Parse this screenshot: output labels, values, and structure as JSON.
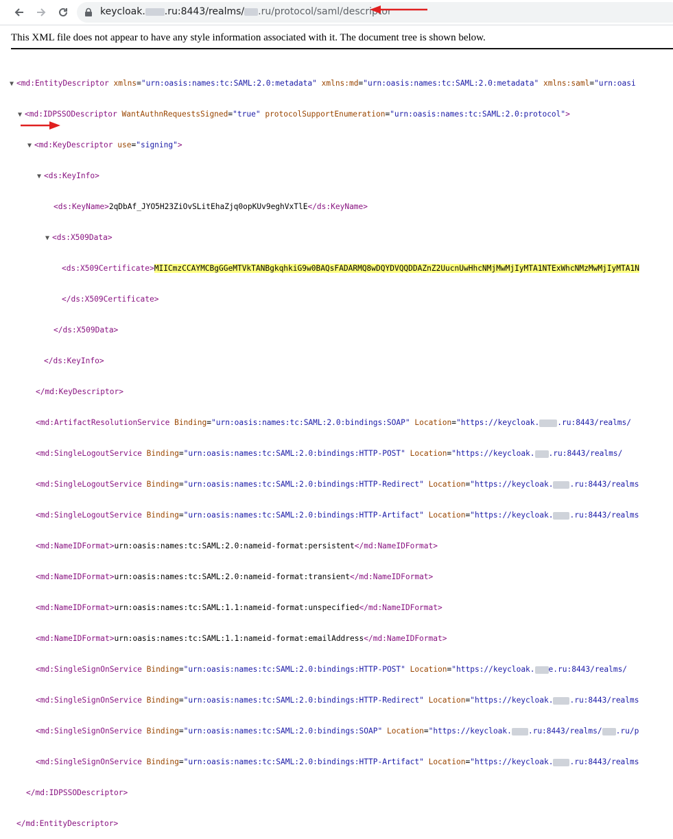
{
  "browser": {
    "url_prefix": "keycloak.",
    "url_mid1": ".ru:8443/realms/",
    "url_mid2": ".ru/protocol/saml/descriptor",
    "icons": [
      "back-icon",
      "forward-icon",
      "reload-icon",
      "lock-icon"
    ]
  },
  "notice": "This XML file does not appear to have any style information associated with it. The document tree is shown below.",
  "xml": {
    "l1": {
      "tag": "<md:EntityDescriptor",
      "a1": "xmlns",
      "v1": "\"urn:oasis:names:tc:SAML:2.0:metadata\"",
      "a2": "xmlns:md",
      "v2": "\"urn:oasis:names:tc:SAML:2.0:metadata\"",
      "a3": "xmlns:saml",
      "v3": "\"urn:oasi"
    },
    "l2": {
      "tag": "<md:IDPSSODescriptor",
      "a1": "WantAuthnRequestsSigned",
      "v1": "\"true\"",
      "a2": "protocolSupportEnumeration",
      "v2": "\"urn:oasis:names:tc:SAML:2.0:protocol\"",
      "end": ">"
    },
    "l3": {
      "tag": "<md:KeyDescriptor",
      "a1": "use",
      "v1": "\"signing\"",
      "end": ">"
    },
    "l4": {
      "tag": "<ds:KeyInfo>"
    },
    "l5": {
      "open": "<ds:KeyName>",
      "text": "2qDbAf_JYO5H23ZiOvSLitEhaZjq0opKUv9eghVxTlE",
      "close": "</ds:KeyName>"
    },
    "l6": {
      "tag": "<ds:X509Data>"
    },
    "l7": {
      "open": "<ds:X509Certificate>",
      "text": "MIICmzCCAYMCBgGGeMTVkTANBgkqhkiG9w0BAQsFADARMQ8wDQYDVQQDDAZnZ2UucnUwHhcNMjMwMjIyMTA1NTExWhcNMzMwMjIyMTA1N"
    },
    "l8": {
      "close": "</ds:X509Certificate>"
    },
    "l9": {
      "close": "</ds:X509Data>"
    },
    "l10": {
      "close": "</ds:KeyInfo>"
    },
    "l11": {
      "close": "</md:KeyDescriptor>"
    },
    "l12": {
      "tag": "<md:ArtifactResolutionService",
      "a1": "Binding",
      "v1": "\"urn:oasis:names:tc:SAML:2.0:bindings:SOAP\"",
      "a2": "Location",
      "v2": "\"https://keycloak.",
      "v2b": ".ru:8443/realms/"
    },
    "l13": {
      "tag": "<md:SingleLogoutService",
      "a1": "Binding",
      "v1": "\"urn:oasis:names:tc:SAML:2.0:bindings:HTTP-POST\"",
      "a2": "Location",
      "v2": "\"https://keycloak.",
      "v2b": ".ru:8443/realms/"
    },
    "l14": {
      "tag": "<md:SingleLogoutService",
      "a1": "Binding",
      "v1": "\"urn:oasis:names:tc:SAML:2.0:bindings:HTTP-Redirect\"",
      "a2": "Location",
      "v2": "\"https://keycloak.",
      "v2b": ".ru:8443/realms"
    },
    "l15": {
      "tag": "<md:SingleLogoutService",
      "a1": "Binding",
      "v1": "\"urn:oasis:names:tc:SAML:2.0:bindings:HTTP-Artifact\"",
      "a2": "Location",
      "v2": "\"https://keycloak.",
      "v2b": ".ru:8443/realms"
    },
    "l16": {
      "open": "<md:NameIDFormat>",
      "text": "urn:oasis:names:tc:SAML:2.0:nameid-format:persistent",
      "close": "</md:NameIDFormat>"
    },
    "l17": {
      "open": "<md:NameIDFormat>",
      "text": "urn:oasis:names:tc:SAML:2.0:nameid-format:transient",
      "close": "</md:NameIDFormat>"
    },
    "l18": {
      "open": "<md:NameIDFormat>",
      "text": "urn:oasis:names:tc:SAML:1.1:nameid-format:unspecified",
      "close": "</md:NameIDFormat>"
    },
    "l19": {
      "open": "<md:NameIDFormat>",
      "text": "urn:oasis:names:tc:SAML:1.1:nameid-format:emailAddress",
      "close": "</md:NameIDFormat>"
    },
    "l20": {
      "tag": "<md:SingleSignOnService",
      "a1": "Binding",
      "v1": "\"urn:oasis:names:tc:SAML:2.0:bindings:HTTP-POST\"",
      "a2": "Location",
      "v2": "\"https://keycloak.",
      "v2b": "e.ru:8443/realms/"
    },
    "l21": {
      "tag": "<md:SingleSignOnService",
      "a1": "Binding",
      "v1": "\"urn:oasis:names:tc:SAML:2.0:bindings:HTTP-Redirect\"",
      "a2": "Location",
      "v2": "\"https://keycloak.",
      "v2b": ".ru:8443/realms"
    },
    "l22": {
      "tag": "<md:SingleSignOnService",
      "a1": "Binding",
      "v1": "\"urn:oasis:names:tc:SAML:2.0:bindings:SOAP\"",
      "a2": "Location",
      "v2": "\"https://keycloak.",
      "v2b": ".ru:8443/realms/",
      "v2c": ".ru/p"
    },
    "l23": {
      "tag": "<md:SingleSignOnService",
      "a1": "Binding",
      "v1": "\"urn:oasis:names:tc:SAML:2.0:bindings:HTTP-Artifact\"",
      "a2": "Location",
      "v2": "\"https://keycloak.",
      "v2b": ".ru:8443/realms"
    },
    "l24": {
      "close": "</md:IDPSSODescriptor>"
    },
    "l25": {
      "close": "</md:EntityDescriptor>"
    }
  }
}
